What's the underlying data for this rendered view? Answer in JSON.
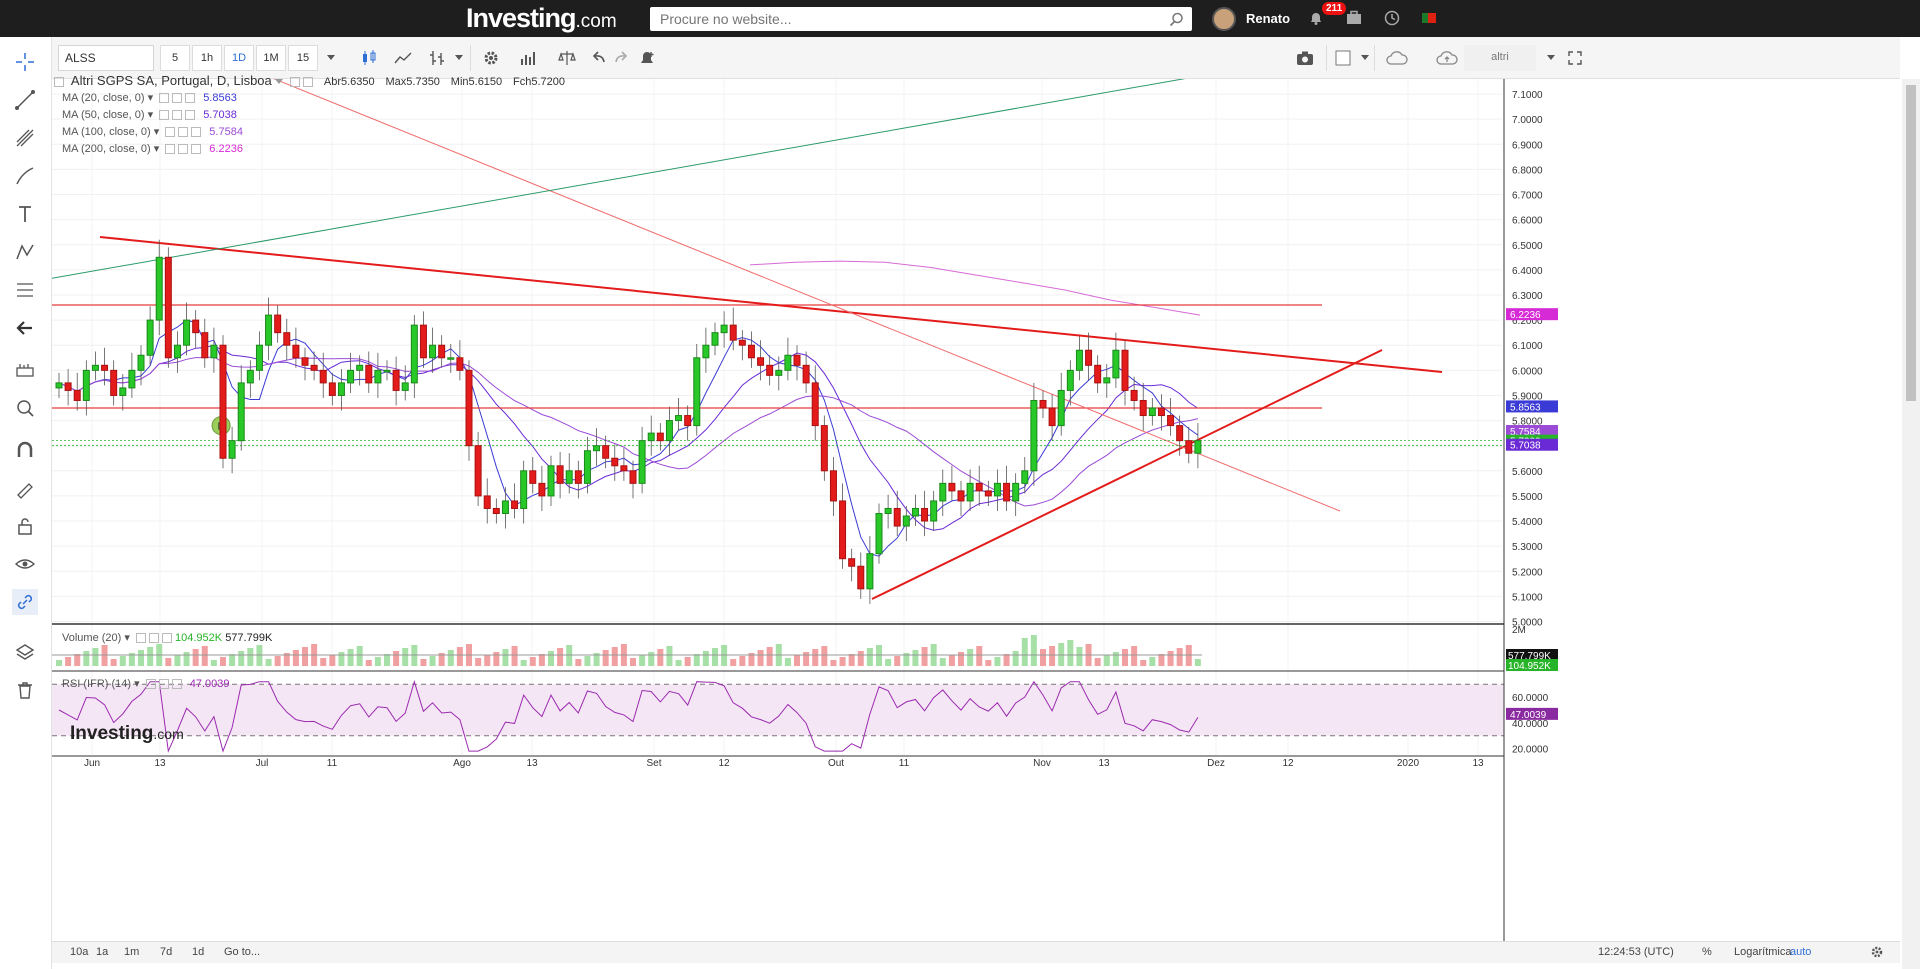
{
  "topbar": {
    "logo_main": "Investing",
    "logo_suffix": ".com",
    "search_placeholder": "Procure no website...",
    "user_name": "Renato",
    "notification_count": "211"
  },
  "toolbar": {
    "symbol": "ALSS",
    "intervals": [
      "5",
      "1h",
      "1D",
      "1M",
      "15"
    ],
    "active_interval": "1D",
    "right_label": "altri"
  },
  "legend": {
    "title": "Altri SGPS SA, Portugal, D, Lisboa",
    "open_label": "Abr",
    "open": "5.6350",
    "high_label": "Max",
    "high": "5.7350",
    "low_label": "Min",
    "low": "5.6150",
    "close_label": "Fch",
    "close": "5.7200",
    "ma": [
      {
        "label": "MA (20, close, 0)",
        "value": "5.8563",
        "color": "#3a3ad6"
      },
      {
        "label": "MA (50, close, 0)",
        "value": "5.7038",
        "color": "#6a2ad6"
      },
      {
        "label": "MA (100, close, 0)",
        "value": "5.7584",
        "color": "#9b4bd6"
      },
      {
        "label": "MA (200, close, 0)",
        "value": "6.2236",
        "color": "#d62ad6"
      }
    ],
    "volume_label": "Volume (20)",
    "volume_value": "104.952K",
    "volume_ma": "577.799K",
    "rsi_label": "RSI (IFR) (14)",
    "rsi_value": "47.0039",
    "event_marker": "D"
  },
  "chart_data": {
    "type": "candlestick",
    "y_range": [
      4.99,
      7.16
    ],
    "price_ticks": [
      "7.1000",
      "7.0000",
      "6.9000",
      "6.8000",
      "6.7000",
      "6.6000",
      "6.5000",
      "6.4000",
      "6.3000",
      "6.2000",
      "6.1000",
      "6.0000",
      "5.9000",
      "5.8000",
      "5.7000",
      "5.6000",
      "5.5000",
      "5.4000",
      "5.3000",
      "5.2000",
      "5.1000",
      "5.0000"
    ],
    "x_tick_labels": [
      "Jun",
      "13",
      "Jul",
      "11",
      "Ago",
      "13",
      "Set",
      "12",
      "Out",
      "11",
      "Nov",
      "13",
      "Dez",
      "12",
      "2020",
      "13"
    ],
    "price_badges": [
      {
        "label": "6.2236",
        "value": 6.2236,
        "color": "#d62ad6"
      },
      {
        "label": "5.8563",
        "value": 5.8563,
        "color": "#3a3ad6"
      },
      {
        "label": "5.7584",
        "value": 5.7584,
        "color": "#9b4bd6"
      },
      {
        "label": "5.7200",
        "value": 5.72,
        "color": "#28b428"
      },
      {
        "label": "5.7038",
        "value": 5.7038,
        "color": "#6a2ad6"
      }
    ],
    "horizontal_lines": [
      6.26,
      5.85
    ],
    "closes": [
      5.95,
      5.92,
      5.88,
      6.0,
      6.02,
      6.0,
      5.9,
      5.93,
      6.0,
      6.06,
      6.2,
      6.45,
      6.05,
      6.1,
      6.2,
      6.15,
      6.05,
      6.1,
      5.65,
      5.72,
      5.95,
      6.0,
      6.1,
      6.22,
      6.15,
      6.1,
      6.05,
      6.02,
      6.0,
      5.95,
      5.9,
      5.95,
      6.0,
      6.02,
      5.95,
      6.0,
      6.0,
      5.92,
      5.95,
      6.18,
      6.05,
      6.1,
      6.05,
      6.05,
      6.0,
      5.7,
      5.5,
      5.45,
      5.43,
      5.48,
      5.45,
      5.6,
      5.55,
      5.5,
      5.62,
      5.55,
      5.6,
      5.55,
      5.68,
      5.7,
      5.65,
      5.62,
      5.6,
      5.55,
      5.72,
      5.75,
      5.72,
      5.8,
      5.82,
      5.78,
      6.05,
      6.1,
      6.15,
      6.18,
      6.12,
      6.1,
      6.05,
      6.02,
      5.98,
      6.0,
      6.06,
      6.02,
      5.95,
      5.78,
      5.6,
      5.48,
      5.25,
      5.22,
      5.13,
      5.27,
      5.43,
      5.45,
      5.38,
      5.42,
      5.45,
      5.4,
      5.48,
      5.55,
      5.52,
      5.48,
      5.55,
      5.52,
      5.5,
      5.55,
      5.48,
      5.55,
      5.6,
      5.88,
      5.85,
      5.78,
      5.92,
      6.0,
      6.08,
      6.02,
      5.95,
      5.97,
      6.08,
      5.92,
      5.88,
      5.82,
      5.85,
      5.82,
      5.78,
      5.72,
      5.67,
      5.72
    ],
    "rsi_levels": [
      70,
      30
    ],
    "rsi_tick_labels": [
      "60.0000",
      "40.0000",
      "20.0000"
    ],
    "volume_tick_labels": [
      "2M"
    ]
  },
  "bottombar": {
    "ranges": [
      "10a",
      "1a",
      "1m",
      "7d",
      "1d"
    ],
    "goto": "Go to...",
    "time": "12:24:53 (UTC)",
    "pct": "%",
    "log": "Logarítmica",
    "auto": "auto"
  },
  "watermark": {
    "main": "Investing",
    "suffix": ".com"
  }
}
